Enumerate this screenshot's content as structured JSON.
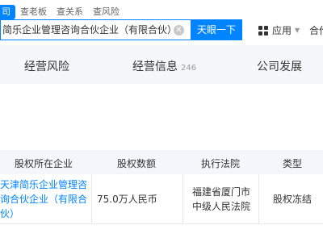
{
  "search_tabs": [
    "司",
    "查老板",
    "查关系",
    "查风险"
  ],
  "search": {
    "value": "简乐企业管理咨询合伙企业（有限合伙）",
    "button": "天眼一下"
  },
  "header_right": {
    "app_label": "应用",
    "partner_label": "合作"
  },
  "nav": [
    {
      "label": "经营风险",
      "count": ""
    },
    {
      "label": "经营信息",
      "count": "246"
    },
    {
      "label": "公司发展",
      "count": ""
    }
  ],
  "table": {
    "headers": [
      "股权所在企业",
      "股权数额",
      "执行法院",
      "类型"
    ],
    "rows": [
      {
        "company": "天津简乐企业管理咨询合伙企业（有限合伙）",
        "amount": "75.0万人民币",
        "court": "福建省厦门市中级人民法院",
        "type": "股权冻结"
      }
    ]
  },
  "colors": {
    "accent": "#0084ff",
    "header_bg": "#f3f7fc",
    "nav_bg": "#f5f7fa"
  }
}
